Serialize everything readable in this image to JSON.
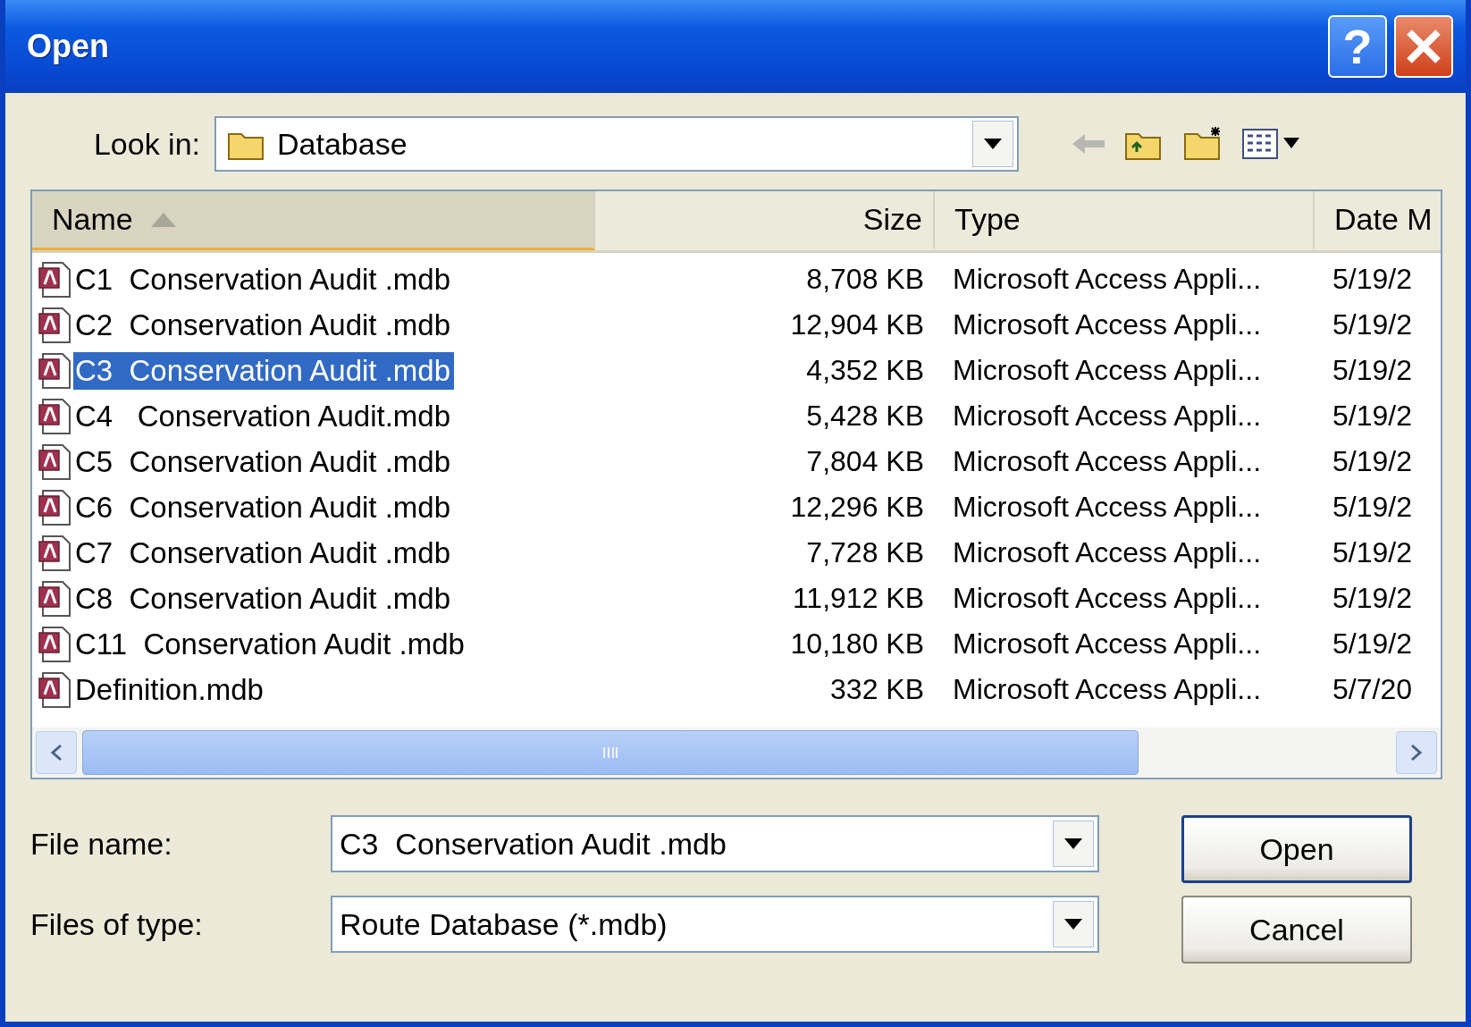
{
  "window": {
    "title": "Open",
    "help_button": "?"
  },
  "look_in": {
    "label": "Look in:",
    "value": "Database"
  },
  "columns": [
    {
      "label": "Name",
      "sorted": true
    },
    {
      "label": "Size",
      "sorted": false
    },
    {
      "label": "Type",
      "sorted": false
    },
    {
      "label": "Date M",
      "sorted": false
    }
  ],
  "files": [
    {
      "name": "C1  Conservation Audit .mdb",
      "size": "8,708 KB",
      "type": "Microsoft Access Appli...",
      "date": "5/19/2",
      "selected": false
    },
    {
      "name": "C2  Conservation Audit .mdb",
      "size": "12,904 KB",
      "type": "Microsoft Access Appli...",
      "date": "5/19/2",
      "selected": false
    },
    {
      "name": "C3  Conservation Audit .mdb",
      "size": "4,352 KB",
      "type": "Microsoft Access Appli...",
      "date": "5/19/2",
      "selected": true
    },
    {
      "name": "C4   Conservation Audit.mdb",
      "size": "5,428 KB",
      "type": "Microsoft Access Appli...",
      "date": "5/19/2",
      "selected": false
    },
    {
      "name": "C5  Conservation Audit .mdb",
      "size": "7,804 KB",
      "type": "Microsoft Access Appli...",
      "date": "5/19/2",
      "selected": false
    },
    {
      "name": "C6  Conservation Audit .mdb",
      "size": "12,296 KB",
      "type": "Microsoft Access Appli...",
      "date": "5/19/2",
      "selected": false
    },
    {
      "name": "C7  Conservation Audit .mdb",
      "size": "7,728 KB",
      "type": "Microsoft Access Appli...",
      "date": "5/19/2",
      "selected": false
    },
    {
      "name": "C8  Conservation Audit .mdb",
      "size": "11,912 KB",
      "type": "Microsoft Access Appli...",
      "date": "5/19/2",
      "selected": false
    },
    {
      "name": "C11  Conservation Audit .mdb",
      "size": "10,180 KB",
      "type": "Microsoft Access Appli...",
      "date": "5/19/2",
      "selected": false
    },
    {
      "name": "Definition.mdb",
      "size": "332 KB",
      "type": "Microsoft Access Appli...",
      "date": "5/7/20",
      "selected": false
    }
  ],
  "file_name": {
    "label": "File name:",
    "value": "C3  Conservation Audit .mdb"
  },
  "files_of_type": {
    "label": "Files of type:",
    "value": "Route Database (*.mdb)"
  },
  "buttons": [
    {
      "label": "Open",
      "default": true
    },
    {
      "label": "Cancel",
      "default": false
    }
  ]
}
